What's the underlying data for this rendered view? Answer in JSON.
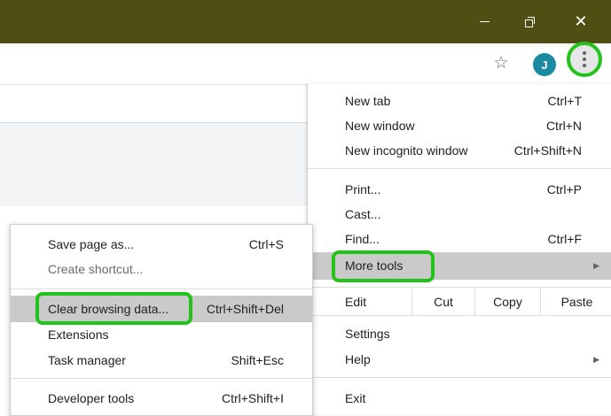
{
  "titlebar": {
    "minimize_glyph": "—",
    "restore_glyph": "❐",
    "close_glyph": "✕",
    "color": "#4f4f14"
  },
  "toolbar": {
    "star_glyph": "☆",
    "avatar_letter": "J",
    "avatar_color": "#1a8aa0"
  },
  "main_menu": {
    "items": [
      {
        "label": "New tab",
        "shortcut": "Ctrl+T"
      },
      {
        "label": "New window",
        "shortcut": "Ctrl+N"
      },
      {
        "label": "New incognito window",
        "shortcut": "Ctrl+Shift+N"
      },
      {
        "label": "Print...",
        "shortcut": "Ctrl+P"
      },
      {
        "label": "Cast...",
        "shortcut": ""
      },
      {
        "label": "Find...",
        "shortcut": "Ctrl+F"
      },
      {
        "label": "More tools",
        "shortcut": ""
      },
      {
        "label": "Settings",
        "shortcut": ""
      },
      {
        "label": "Help",
        "shortcut": ""
      },
      {
        "label": "Exit",
        "shortcut": ""
      }
    ],
    "edit": {
      "label": "Edit",
      "cut": "Cut",
      "copy": "Copy",
      "paste": "Paste"
    },
    "arrow_glyph": "▶"
  },
  "sub_menu": {
    "items": [
      {
        "label": "Save page as...",
        "shortcut": "Ctrl+S"
      },
      {
        "label": "Create shortcut...",
        "shortcut": ""
      },
      {
        "label": "Clear browsing data...",
        "shortcut": "Ctrl+Shift+Del"
      },
      {
        "label": "Extensions",
        "shortcut": ""
      },
      {
        "label": "Task manager",
        "shortcut": "Shift+Esc"
      },
      {
        "label": "Developer tools",
        "shortcut": "Ctrl+Shift+I"
      }
    ]
  },
  "highlight_color": "#22c21a"
}
